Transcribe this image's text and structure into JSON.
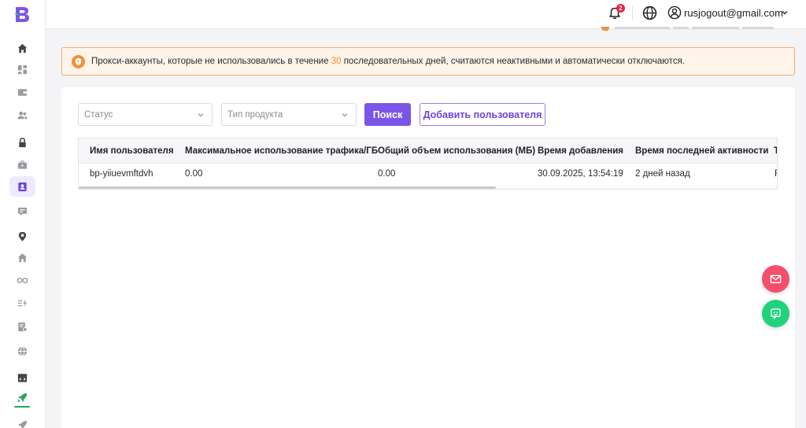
{
  "topbar": {
    "notification_count": "2",
    "user_email": "rusjogout@gmail.com"
  },
  "sidebar": {
    "items": [
      {
        "icon": "home-icon"
      },
      {
        "icon": "dashboard-icon"
      },
      {
        "icon": "wallet-icon"
      },
      {
        "icon": "users-icon"
      },
      {
        "icon": "lock-icon"
      },
      {
        "icon": "briefcase-icon"
      },
      {
        "icon": "contact-card-icon",
        "active": true
      },
      {
        "icon": "message-icon"
      },
      {
        "icon": "location-pin-icon"
      },
      {
        "icon": "building-icon"
      },
      {
        "icon": "infinity-icon"
      },
      {
        "icon": "lightning-list-icon"
      },
      {
        "icon": "document-settings-icon"
      },
      {
        "icon": "globe-icon"
      },
      {
        "icon": "code-icon"
      },
      {
        "icon": "rocket-icon"
      },
      {
        "icon": "rocket-outline-icon"
      }
    ]
  },
  "banner": {
    "text_before": "Прокси-аккаунты, которые не использовались в течение ",
    "days": "30",
    "text_after": " последовательных дней, считаются неактивными и автоматически отключаются."
  },
  "filters": {
    "status_placeholder": "Статус",
    "product_type_placeholder": "Тип продукта",
    "search_label": "Поиск",
    "add_user_label": "Добавить пользователя"
  },
  "table": {
    "columns": [
      "Имя пользователя",
      "Максимальное использование трафика/ГБ",
      "Общий объем использования (МБ)",
      "Время добавления",
      "Время последней активности",
      "Т"
    ],
    "rows": [
      [
        "bp-yiiuevmftdvh",
        "0.00",
        "0.00",
        "30.09.2025, 13:54:19",
        "2 дней назад",
        "F"
      ]
    ]
  },
  "colors": {
    "accent": "#7b55e8",
    "banner_bg": "#fff4ea",
    "banner_border": "#f3a971",
    "warning": "#f0913f",
    "badge": "#e5243b",
    "mail_fab": "#f54f6d",
    "chat_fab": "#1fd37b"
  }
}
